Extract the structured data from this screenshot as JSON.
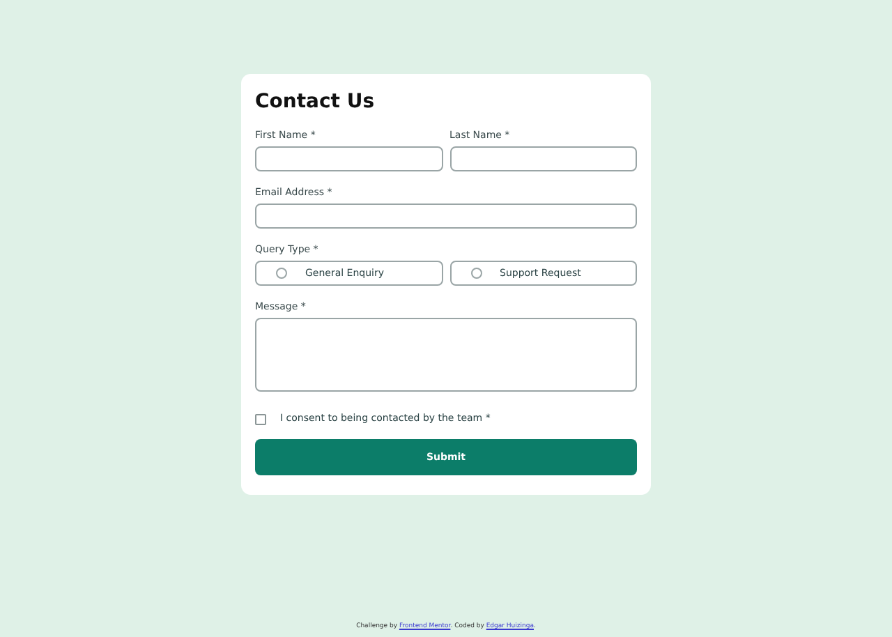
{
  "form": {
    "title": "Contact Us",
    "name_fields": [
      {
        "label": "First Name *"
      },
      {
        "label": "Last Name *"
      }
    ],
    "email": {
      "label": "Email Address *"
    },
    "query_type": {
      "label": "Query Type *",
      "options": [
        {
          "label": "General Enquiry",
          "selected": false
        },
        {
          "label": "Support Request",
          "selected": false
        }
      ]
    },
    "message": {
      "label": "Message *"
    },
    "consent": {
      "label": "I consent to being contacted by the team *",
      "checked": false
    },
    "submit": "Submit"
  },
  "footer": {
    "parts": [
      {
        "kind": "text",
        "text": "Challenge by "
      },
      {
        "kind": "link",
        "text": "Frontend Mentor"
      },
      {
        "kind": "text",
        "text": ". Coded by "
      },
      {
        "kind": "link",
        "text": "Edgar Huizinga"
      },
      {
        "kind": "text",
        "text": "."
      }
    ]
  }
}
